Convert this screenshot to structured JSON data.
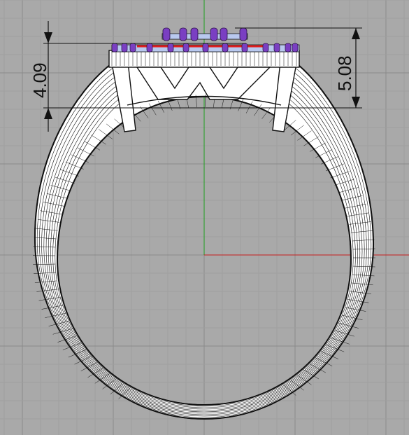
{
  "viewport": {
    "name": "front-view",
    "colors": {
      "background": "#a9a9a9",
      "grid_minor": "#9f9f9f",
      "grid_major": "#8a8a8a",
      "axis_x": "#c81e1e",
      "axis_y": "#1ea01e",
      "wireframe": "#111111",
      "ring_fill": "#ffffff",
      "prong": "#7a3fc2",
      "stone": "#b9c9ef",
      "accent": "#e01e1e",
      "dimension": "#111111"
    }
  },
  "dimensions": {
    "left_value": "4.09",
    "right_value": "5.08"
  },
  "model": {
    "object": "ring-wireframe",
    "icons": [
      "ring-shank",
      "setting-head",
      "gallery-v-bridge",
      "prong-set",
      "pave-stones"
    ]
  }
}
